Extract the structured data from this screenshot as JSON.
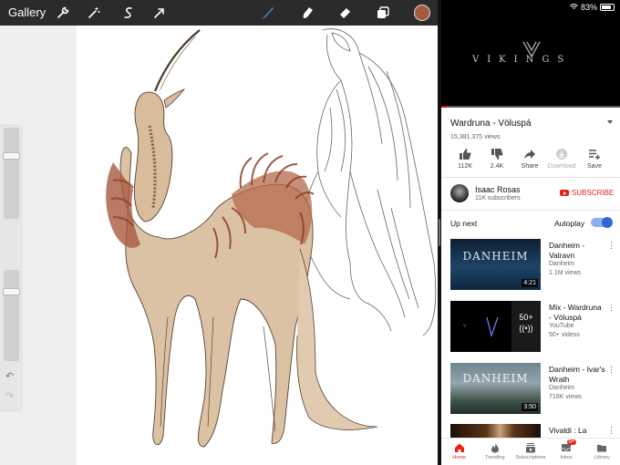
{
  "draw_app": {
    "toolbar": {
      "gallery_label": "Gallery",
      "tools": [
        "wrench-icon",
        "magic-wand-icon",
        "selection-icon",
        "transform-arrow-icon",
        "brush-icon",
        "smudge-icon",
        "eraser-icon",
        "layers-icon"
      ],
      "active_tool": "brush-icon",
      "accent": "#3d8ee0",
      "current_color": "#a25a40"
    },
    "sidebar": {
      "brush_size_level": 0.29,
      "opacity_level": 0.22
    }
  },
  "video_app": {
    "status": {
      "battery": "83%"
    },
    "player": {
      "overlay_title": "VIKINGS",
      "progress": 0.03
    },
    "video": {
      "title": "Wardruna - Völuspá",
      "views": "15,381,375 views",
      "actions": [
        {
          "label": "112K",
          "icon": "thumbs-up-icon"
        },
        {
          "label": "2.4K",
          "icon": "thumbs-down-icon"
        },
        {
          "label": "Share",
          "icon": "share-icon"
        },
        {
          "label": "Download",
          "icon": "download-icon"
        },
        {
          "label": "Save",
          "icon": "add-to-playlist-icon"
        }
      ]
    },
    "channel": {
      "name": "Isaac Rosas",
      "subscribers": "11K subscribers",
      "subscribe_label": "SUBSCRIBE"
    },
    "up_next": {
      "label": "Up next",
      "autoplay_label": "Autoplay",
      "autoplay_on": true
    },
    "recommendations": [
      {
        "title": "Danheim - Valravn",
        "channel": "Danheim",
        "meta": "1.1M views",
        "duration": "4:21",
        "thumb_text": "DANHEIM"
      },
      {
        "title": "Mix - Wardruna - Völuspá",
        "channel": "YouTube",
        "meta": "50+ videos",
        "badge": "50+",
        "thumb_text": "V"
      },
      {
        "title": "Danheim - Ivar's Wrath",
        "channel": "Danheim",
        "meta": "718K views",
        "duration": "3:50",
        "thumb_text": "DANHEIM"
      },
      {
        "title": "Vivaldi : La Follia",
        "channel": "",
        "meta": "",
        "thumb_text": ""
      }
    ],
    "bottom_nav": [
      {
        "label": "Home",
        "icon": "home-icon",
        "active": true
      },
      {
        "label": "Trending",
        "icon": "trending-flame-icon"
      },
      {
        "label": "Subscriptions",
        "icon": "subscriptions-icon"
      },
      {
        "label": "Inbox",
        "icon": "inbox-icon",
        "badge": "9+"
      },
      {
        "label": "Library",
        "icon": "library-folder-icon"
      }
    ],
    "colors": {
      "brand_red": "#e62117",
      "toggle_blue": "#3367d6"
    }
  }
}
